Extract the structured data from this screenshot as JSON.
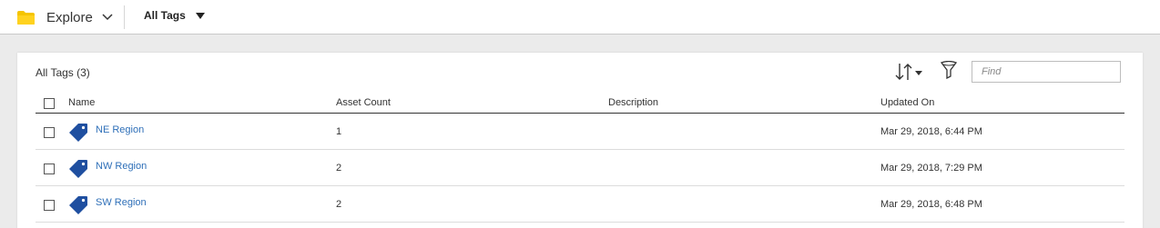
{
  "header": {
    "explore_label": "Explore",
    "view_label": "All Tags"
  },
  "panel": {
    "count_label": "All Tags (3)",
    "find_placeholder": "Find"
  },
  "table": {
    "columns": {
      "name": "Name",
      "asset_count": "Asset Count",
      "description": "Description",
      "updated_on": "Updated On"
    },
    "rows": [
      {
        "name": "NE Region",
        "asset_count": "1",
        "description": "",
        "updated_on": "Mar 29, 2018, 6:44 PM"
      },
      {
        "name": "NW Region",
        "asset_count": "2",
        "description": "",
        "updated_on": "Mar 29, 2018, 7:29 PM"
      },
      {
        "name": "SW Region",
        "asset_count": "2",
        "description": "",
        "updated_on": "Mar 29, 2018, 6:48 PM"
      }
    ]
  },
  "icons": {
    "folder": "folder-icon",
    "chevron": "chevron-down-icon",
    "dropdown": "caret-down-icon",
    "sort": "sort-icon",
    "filter": "filter-icon",
    "tag": "tag-icon"
  },
  "colors": {
    "folder": "#f5c400",
    "tag": "#1f4fa0",
    "link": "#2e6fb8"
  }
}
